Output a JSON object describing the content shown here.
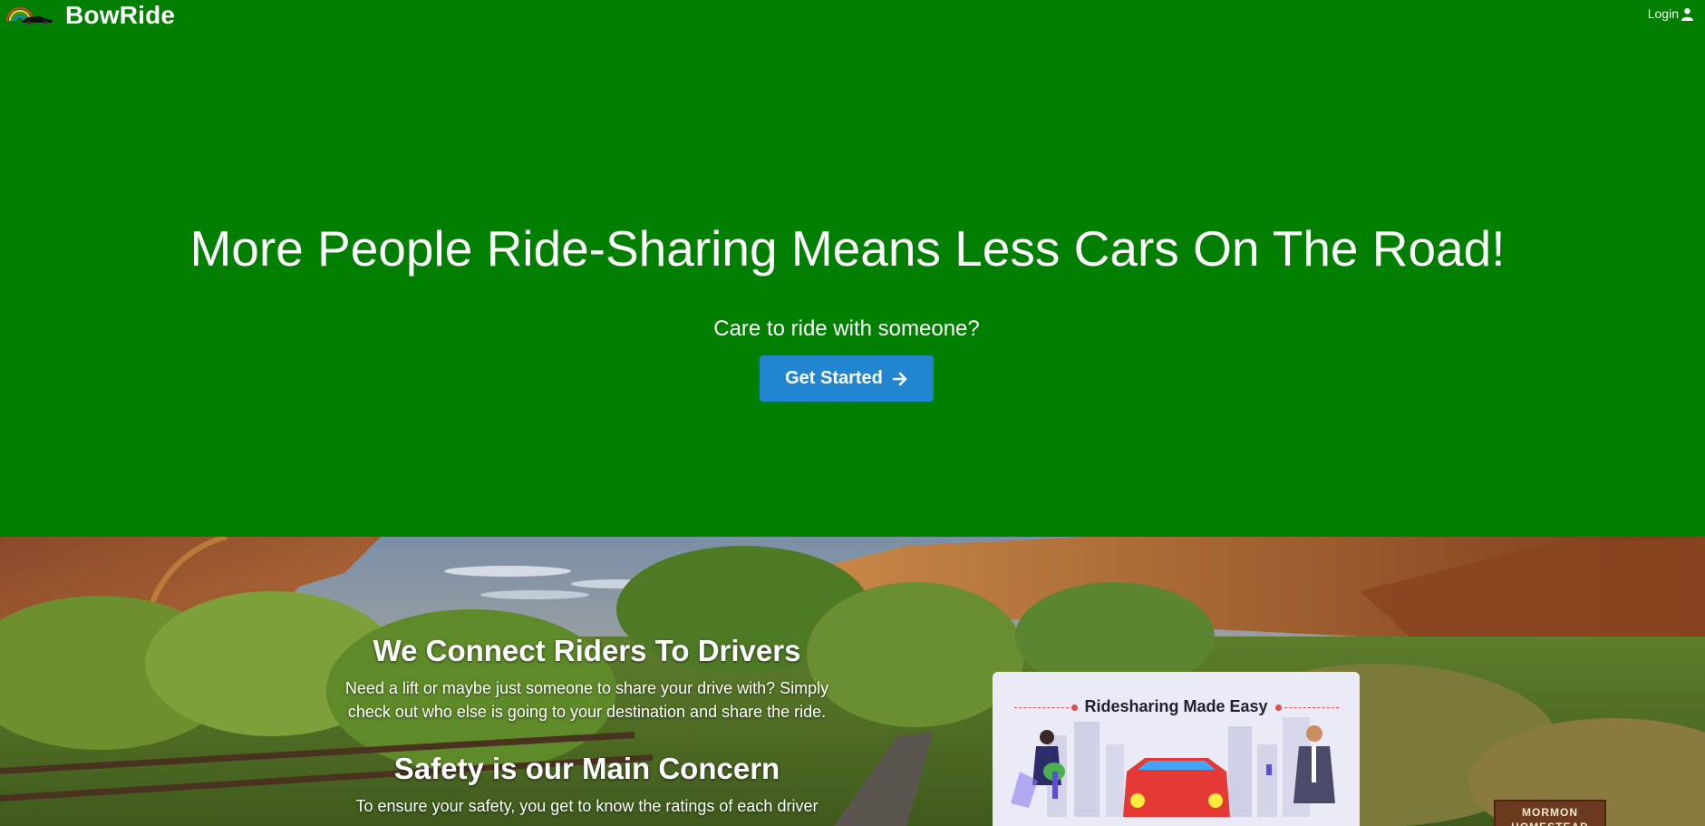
{
  "nav": {
    "brand": "BowRide",
    "login_label": "Login"
  },
  "hero": {
    "title": "More People Ride-Sharing Means Less Cars On The Road!",
    "subtitle": "Care to ride with someone?",
    "cta_label": "Get Started"
  },
  "features": [
    {
      "heading": "We Connect Riders To Drivers",
      "text": "Need a lift or maybe just someone to share your drive with? Simply check out who else is going to your destination and share the ride."
    },
    {
      "heading": "Safety is our Main Concern",
      "text": "To ensure your safety, you get to know the ratings of each driver"
    }
  ],
  "card": {
    "title": "Ridesharing Made Easy"
  },
  "sign": {
    "text": "MORMON HOMESTEAD"
  },
  "colors": {
    "hero_bg": "#007f00",
    "cta_bg": "#2185d0",
    "text": "#ffffff"
  },
  "icons": [
    "rainbow-car-logo-icon",
    "user-icon",
    "arrow-right-icon"
  ]
}
